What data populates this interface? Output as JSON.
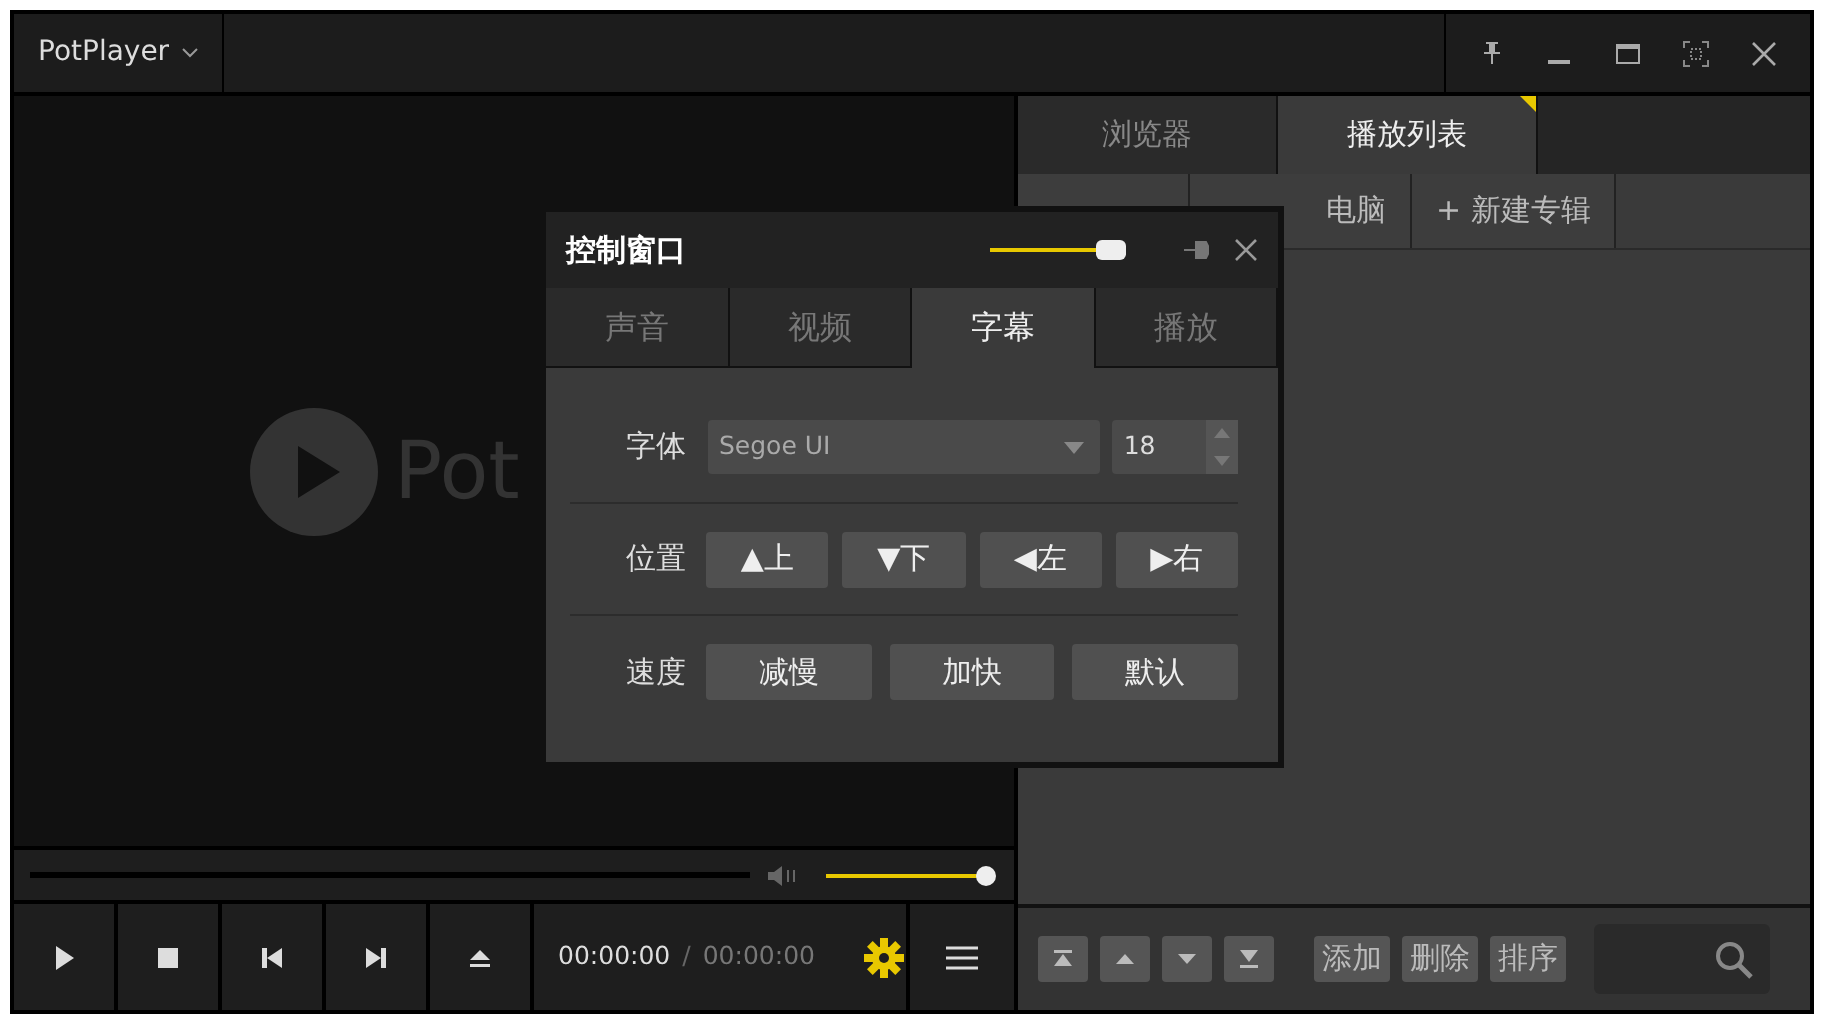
{
  "title_bar": {
    "app_menu": "PotPlayer"
  },
  "video": {
    "logo_text": "Pot"
  },
  "volume": {
    "level": 1
  },
  "controls": {
    "time_current": "00:00:00",
    "separator": "/",
    "time_total": "00:00:00"
  },
  "playlist": {
    "tabs": [
      {
        "label": "浏览器",
        "selected": false
      },
      {
        "label": "播放列表",
        "selected": true
      }
    ],
    "subtabs": [
      {
        "kind": "covered"
      },
      {
        "kind": "tab",
        "label": "电脑"
      },
      {
        "kind": "tab",
        "label": "+ 新建专辑"
      }
    ],
    "buttons": [
      "添加",
      "删除",
      "排序"
    ]
  },
  "dialog": {
    "title": "控制窗口",
    "opacity": {
      "level": 1
    },
    "tabs": [
      {
        "label": "声音",
        "selected": false
      },
      {
        "label": "视频",
        "selected": false
      },
      {
        "label": "字幕",
        "selected": true
      },
      {
        "label": "播放",
        "selected": false
      }
    ],
    "rows": [
      {
        "kind": "font",
        "label": "字体",
        "font": "Segoe UI",
        "size": "18"
      },
      {
        "kind": "buttons",
        "label": "位置",
        "buttons": [
          "▲上",
          "▼下",
          "◀左",
          "▶右"
        ]
      },
      {
        "kind": "buttons",
        "label": "速度",
        "buttons": [
          "减慢",
          "加快",
          "默认"
        ]
      }
    ]
  }
}
